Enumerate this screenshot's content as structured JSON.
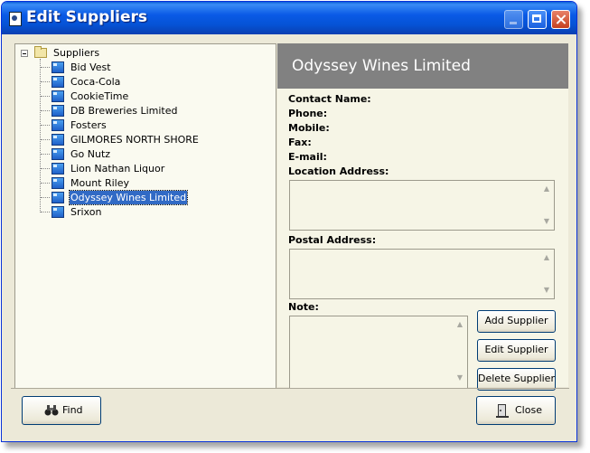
{
  "window": {
    "title": "Edit Suppliers"
  },
  "tree": {
    "root_label": "Suppliers",
    "items": [
      "Bid Vest",
      "Coca-Cola",
      "CookieTime",
      "DB Breweries Limited",
      "Fosters",
      "GILMORES NORTH SHORE",
      "Go Nutz",
      "Lion Nathan Liquor",
      "Mount Riley",
      "Odyssey Wines Limited",
      "Srixon"
    ],
    "selected": "Odyssey Wines Limited"
  },
  "details": {
    "header": "Odyssey Wines Limited",
    "labels": {
      "contact": "Contact Name:",
      "phone": "Phone:",
      "mobile": "Mobile:",
      "fax": "Fax:",
      "email": "E-mail:",
      "location": "Location Address:",
      "postal": "Postal Address:",
      "note": "Note:"
    }
  },
  "buttons": {
    "add": "Add Supplier",
    "edit": "Edit Supplier",
    "delete": "Delete Supplier",
    "find": "Find",
    "close": "Close"
  },
  "icons": [
    "app-icon",
    "minimize-icon",
    "maximize-icon",
    "close-icon",
    "folder-icon",
    "book-icon",
    "binoculars-icon",
    "door-exit-icon",
    "mouse-cursor-icon"
  ]
}
